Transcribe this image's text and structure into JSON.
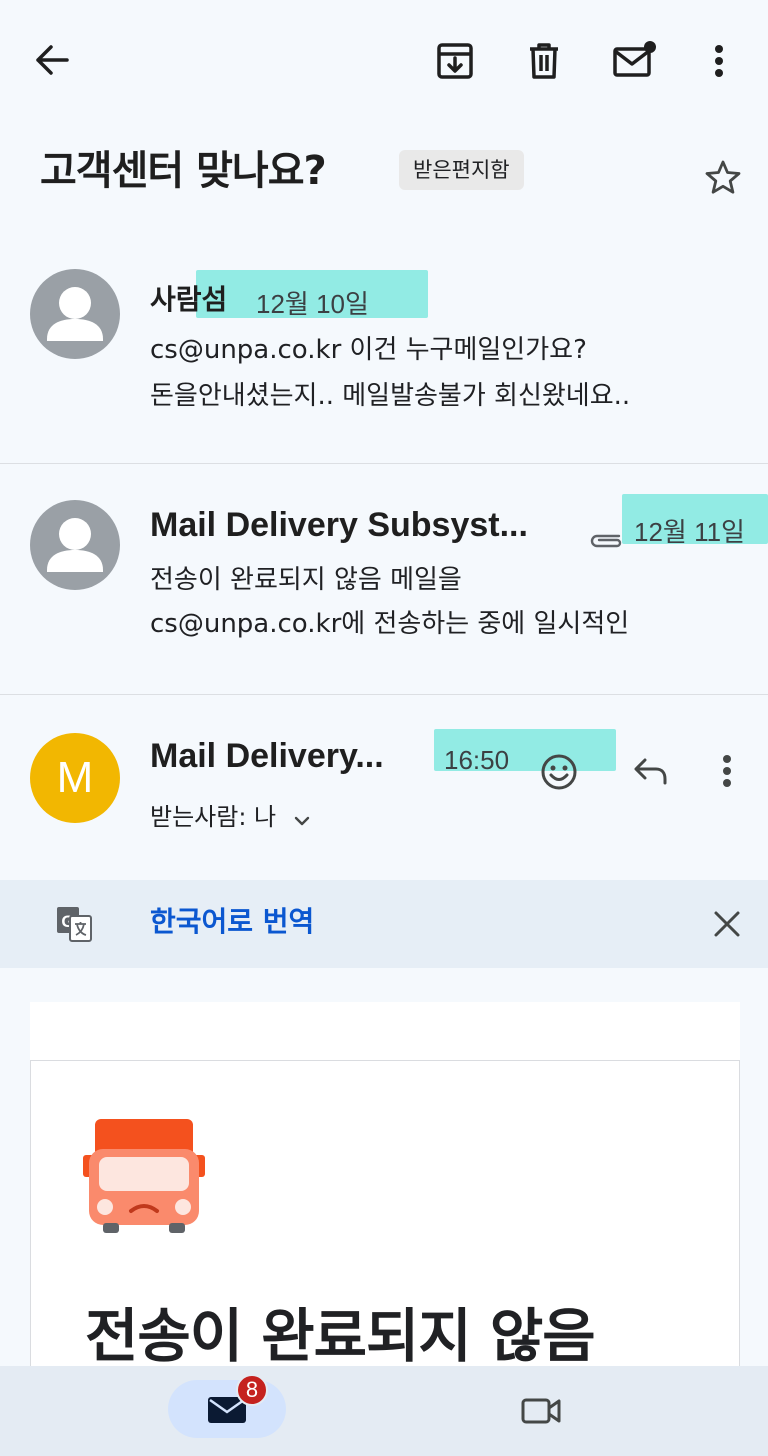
{
  "toolbar": {
    "back": "arrow-back-icon",
    "archive": "archive-icon",
    "delete": "trash-icon",
    "mark_unread": "mail-unread-icon",
    "more": "more-vert-icon"
  },
  "subject": {
    "title": "고객센터 맞나요?",
    "label": "받은편지함",
    "star": "star-outline-icon"
  },
  "messages": [
    {
      "sender": "사람섬",
      "date": "12월 10일",
      "snippet_line1": "cs@unpa.co.kr 이건 누구메일인가요?",
      "snippet_line2": "돈을안내셨는지.. 메일발송불가 회신왔네요.."
    },
    {
      "sender": "Mail Delivery Subsyst...",
      "date": "12월 11일",
      "attachment": "paperclip-icon",
      "snippet_line1": "전송이 완료되지 않음 메일을",
      "snippet_line2": "cs@unpa.co.kr에 전송하는 중에 일시적인"
    },
    {
      "avatar_letter": "M",
      "sender": "Mail Delivery...",
      "time": "16:50",
      "recipient": "받는사람: 나",
      "emoji": "emoji-icon",
      "reply": "reply-icon",
      "more": "more-vert-icon"
    }
  ],
  "translate": {
    "icon": "translate-icon",
    "link": "한국어로 번역",
    "close": "close-icon"
  },
  "mail_body": {
    "illustration": "delivery-truck-icon",
    "title": "전송이 완료되지 않음"
  },
  "bottom_nav": {
    "mail_badge": "8",
    "mail": "mail-icon",
    "meet": "video-icon"
  },
  "colors": {
    "highlight": "#40e0d0",
    "link": "#0b57d0",
    "avatar_m": "#f2b701",
    "badge": "#c5221f"
  }
}
